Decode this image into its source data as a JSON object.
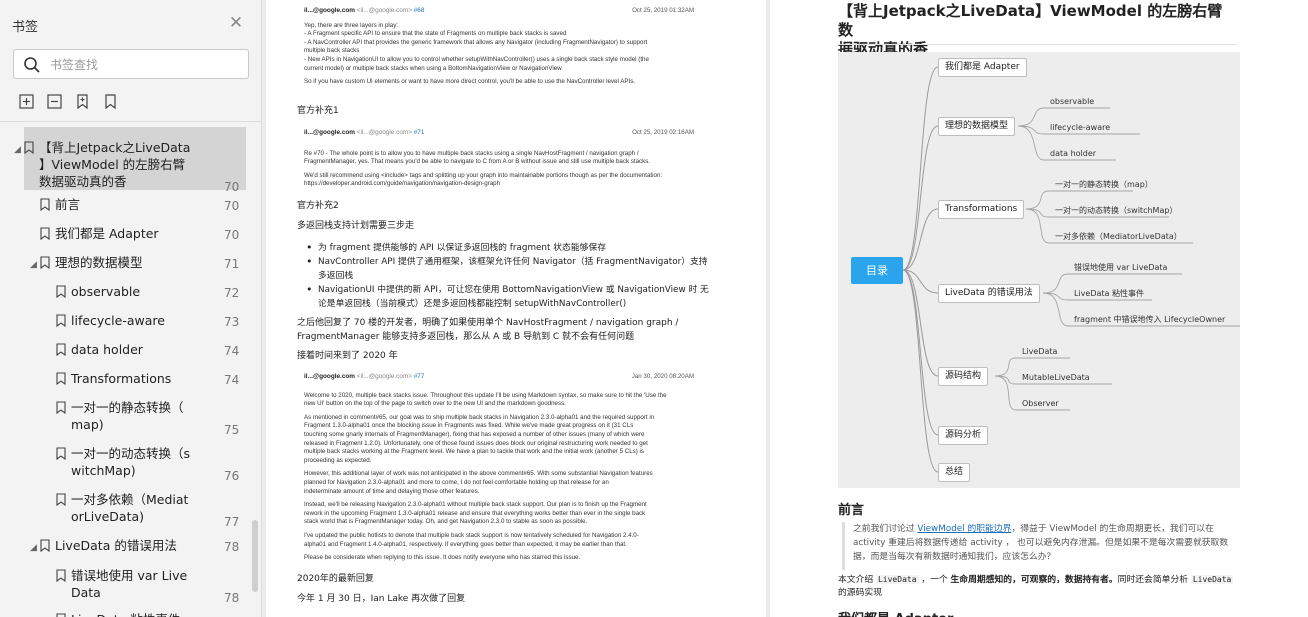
{
  "sidebar": {
    "title": "书签",
    "search_placeholder": "书签查找",
    "toc": [
      {
        "label_lines": [
          "【背上Jetpack之LiveData",
          "】ViewModel 的左膀右臂",
          "数据驱动真的香"
        ],
        "page": "70",
        "level": 0,
        "expanded": true,
        "selected": true
      },
      {
        "label_lines": [
          "前言"
        ],
        "page": "70",
        "level": 1
      },
      {
        "label_lines": [
          "我们都是 Adapter"
        ],
        "page": "70",
        "level": 1
      },
      {
        "label_lines": [
          "理想的数据模型"
        ],
        "page": "71",
        "level": 1,
        "expanded": true
      },
      {
        "label_lines": [
          "observable"
        ],
        "page": "72",
        "level": 2
      },
      {
        "label_lines": [
          "lifecycle-aware"
        ],
        "page": "73",
        "level": 2
      },
      {
        "label_lines": [
          "data holder"
        ],
        "page": "74",
        "level": 2
      },
      {
        "label_lines": [
          "Transformations"
        ],
        "page": "74",
        "level": 2
      },
      {
        "label_lines": [
          "一对一的静态转换（",
          "map)"
        ],
        "page": "75",
        "level": 2
      },
      {
        "label_lines": [
          "一对一的动态转换（s",
          "witchMap)"
        ],
        "page": "76",
        "level": 2
      },
      {
        "label_lines": [
          "一对多依赖（Mediat",
          "orLiveData)"
        ],
        "page": "77",
        "level": 2
      },
      {
        "label_lines": [
          "LiveData 的错误用法"
        ],
        "page": "78",
        "level": 1,
        "expanded": true
      },
      {
        "label_lines": [
          "错误地使用 var Live",
          "Data"
        ],
        "page": "78",
        "level": 2
      },
      {
        "label_lines": [
          "LiveData 粘性事件"
        ],
        "page": "",
        "level": 2
      }
    ]
  },
  "left_page": {
    "snippet1": {
      "author": "il...@google.com",
      "email": "<il...@google.com>",
      "ref": "#68",
      "date": "Oct 25, 2019 01:32AM",
      "lines": [
        "Yep, there are three layers in play:",
        "- A Fragment specific API to ensure that the state of Fragments on multiple back stacks is saved",
        "- A NavController API that provides the generic framework that allows any Navigator (including FragmentNavigator) to support",
        "multiple back stacks",
        "- New APIs in NavigationUI to allow you to control whether setupWithNavController() uses a single back stack style model (the",
        "current model) or multiple back stacks when using a BottomNavigationView or NavigationView",
        "",
        "So if you have custom UI elements or want to have more direct control, you'll be able to use the NavController level APIs."
      ]
    },
    "cn1": "官方补充1",
    "snippet2": {
      "author": "il...@google.com",
      "email": "<il...@google.com>",
      "ref": "#71",
      "date": "Oct 25, 2019 02:16AM",
      "lines": [
        "Re #70 - The whole point is to allow you to have multiple back stacks using a single NavHostFragment / navigation graph /",
        "FragmentManager, yes. That means you'd be able to navigate to C from A or B without issue and still use multiple back stacks.",
        "",
        "We'd still recommend using <include> tags and splitting up your graph into maintainable portions though as per the documentation:",
        "https://developer.android.com/guide/navigation/navigation-design-graph"
      ]
    },
    "cn2": "官方补充2",
    "cn3": "多返回栈支持计划需要三步走",
    "bullets": [
      [
        "为 fragment 提供能够的 API 以保证多返回栈的 fragment 状态能够保存"
      ],
      [
        "NavController API 提供了通用框架，该框架允许任何 Navigator（括 FragmentNavigator）支持",
        "多返回栈"
      ],
      [
        "NavigationUI 中提供的新 API，可让您在使用 BottomNavigationView 或 NavigationView 时 无",
        "论是单返回栈（当前模式）还是多返回栈都能控制 setupWithNavController()"
      ]
    ],
    "cn4_lines": [
      "之后他回复了 70 楼的开发者，明确了如果使用单个 NavHostFragment / navigation graph /",
      "FragmentManager 能够支持多返回栈，那么从 A 或 B 导航到 C 就不会有任何问题"
    ],
    "cn5": "接着时间来到了 2020 年",
    "snippet3": {
      "author": "il...@google.com",
      "email": "<il...@google.com>",
      "ref": "#77",
      "date": "Jan 30, 2020 08:20AM",
      "lines": [
        "Welcome to 2020, multiple back stacks issue. Throughout this update I'll be using Markdown syntax, so make sure to hit the 'Use the",
        "new UI' button on the top of the page to switch over to the new UI and the markdown goodness.",
        "",
        "As mentioned in comment#65, our goal was to ship multiple back stacks in Navigation 2.3.0-alpha01 and the required support in",
        "Fragment 1.3.0-alpha01 once the blocking issue in Fragments was fixed. While we've made great progress on it (31 CLs",
        "touching some gnarly internals of FragmentManager), fixing that has exposed a number of other issues (many of which were",
        "released in Fragment 1.2.0). Unfortunately, one of those found issues does block our original restructuring work needed to get",
        "multiple back stacks working at the Fragment level. We have a plan to tackle that work and the initial work (another 5 CLs) is",
        "proceeding as expected.",
        "",
        "However, this additional layer of work was not anticipated in the above comment#65. With some substantial Navigation features",
        "planned for Navigation 2.3.0-alpha01 and more to come, I do not feel comfortable holding up that release for an",
        "indeterminate amount of time and delaying those other features.",
        "",
        "Instead, we'll be releasing Navigation 2.3.0-alpha01 without multiple back stack support. Our plan is to finish up the Fragment",
        "rework in the upcoming Fragment 1.3.0-alpha01 release and ensure that everything works better than ever in the single back",
        "stack world that is FragmentManager today. Oh, and get Navigation 2.3.0 to stable as soon as possible.",
        "",
        "I've updated the public hotlists to denote that multiple back stack support is now tentatively scheduled for Navigation 2.4.0-",
        "alpha01 and Fragment 1.4.0-alpha01, respectively. If everything goes better than expected, it may be earlier than that.",
        "",
        "Please be considerate when replying to this issue. It does notify everyone who has starred this issue."
      ]
    },
    "cn6": "2020年的最新回复",
    "cn7": "今年 1 月 30 日，Ian Lake 再次做了回复"
  },
  "right_page": {
    "title_lines": [
      "【背上Jetpack之LiveData】ViewModel 的左膀右臂 数",
      "据驱动真的香"
    ],
    "mindmap": {
      "root": "目录",
      "nodes": [
        {
          "label": "我们都是 Adapter",
          "children": []
        },
        {
          "label": "理想的数据模型",
          "children": [
            "observable",
            "lifecycle-aware",
            "data holder"
          ]
        },
        {
          "label": "Transformations",
          "children": [
            "一对一的静态转换（map）",
            "一对一的动态转换（switchMap）",
            "一对多依赖（MediatorLiveData）"
          ]
        },
        {
          "label": "LiveData 的错误用法",
          "children": [
            "错误地使用 var LiveData",
            "LiveData 粘性事件",
            "fragment 中错误地传入 LifecycleOwner"
          ]
        },
        {
          "label": "源码结构",
          "children": [
            "LiveData",
            "MutableLiveData",
            "Observer"
          ]
        },
        {
          "label": "源码分析",
          "children": []
        },
        {
          "label": "总结",
          "children": []
        }
      ]
    },
    "section1": "前言",
    "quote_prefix": "之前我们讨论过 ",
    "quote_link": "ViewModel 的职能边界",
    "quote_rest1": "，得益于 ViewModel 的生命周期更长，我们可以在",
    "quote_line2": "activity 重建后将数据传递给 activity ， 也可以避免内存泄漏。但是如果不是每次需要就获取数",
    "quote_line3": "据，而是当每次有新数据时通知我们，应该怎么办？",
    "para_a": "本文介绍 ",
    "para_mono1": "LiveData",
    "para_b": " ，一个 ",
    "para_bold": "生命周期感知的，可观察的，数据持有者。",
    "para_c": "同时还会简单分析 ",
    "para_mono2": "LiveData",
    "para_line2": "的源码实现",
    "section2": "我们都是 Adapter"
  },
  "colors": {
    "root_node": "#2aa4ed",
    "link": "#1a6fb8",
    "sidebar_bg": "#f3f3f3",
    "selected_bg": "#d4d4d4"
  }
}
